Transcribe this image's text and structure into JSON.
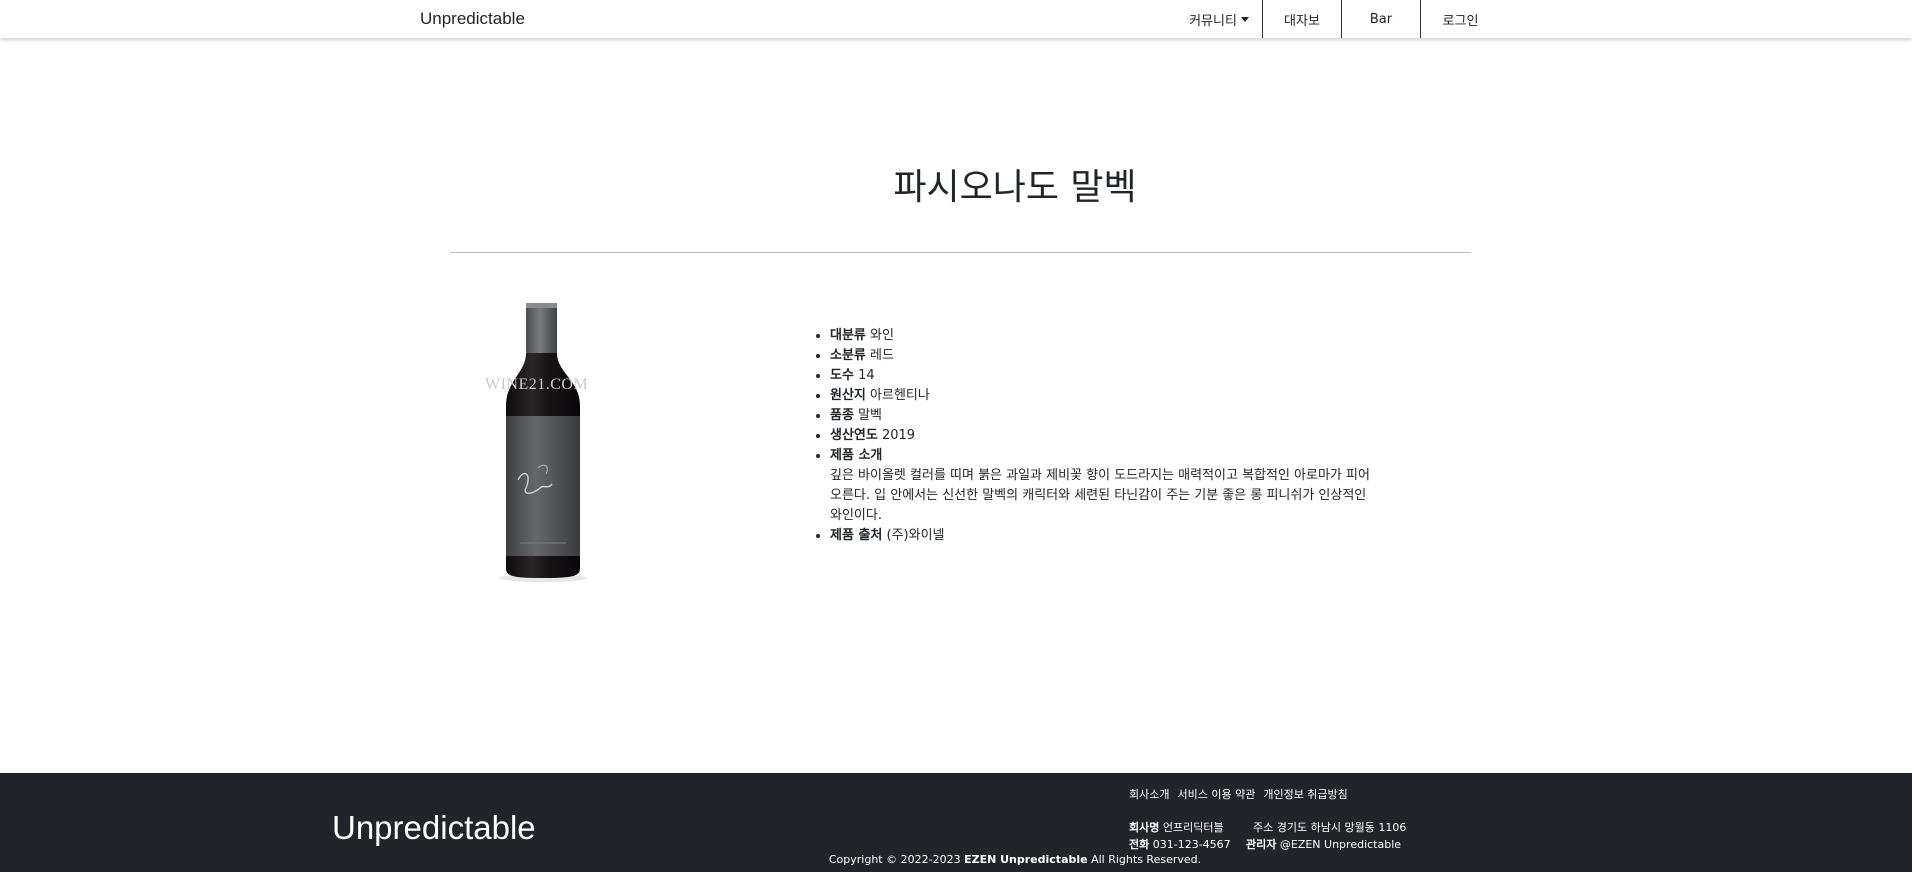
{
  "header": {
    "brand": "Unpredictable",
    "nav": [
      {
        "label": "커뮤니티"
      },
      {
        "label": "대자보"
      },
      {
        "label": "Bar"
      },
      {
        "label": "로그인"
      }
    ]
  },
  "product": {
    "title": "파시오나도 말벡",
    "image_watermark": "WINE21.COM",
    "specs": [
      {
        "label": "대분류",
        "value": "와인"
      },
      {
        "label": "소분류",
        "value": "레드"
      },
      {
        "label": "도수",
        "value": "14"
      },
      {
        "label": "원산지",
        "value": "아르헨티나"
      },
      {
        "label": "품종",
        "value": "말벡"
      },
      {
        "label": "생산연도",
        "value": "2019"
      }
    ],
    "intro_label": "제품 소개",
    "intro_text": "깊은 바이올렛 컬러를 띠며 붉은 과일과 제비꽃 향이 도드라지는 매력적이고 복합적인 아로마가 피어 오른다. 입 안에서는 신선한 말벡의 캐릭터와 세련된 타닌감이 주는 기분 좋은 롱 피니쉬가 인상적인 와인이다.",
    "source_label": "제품 출처",
    "source_value": "(주)와이넬"
  },
  "footer": {
    "brand": "Unpredictable",
    "links": [
      "회사소개",
      "서비스 이용 약관",
      "개인정보 취급방침"
    ],
    "company_label": "회사명",
    "company_value": "언프리딕터블",
    "address_label": "주소",
    "address_value": "경기도 하남시 망월동 1106",
    "phone_label": "전화",
    "phone_value": "031-123-4567",
    "admin_label": "관리자",
    "admin_value": "@EZEN Unpredictable",
    "copyright_prefix": "Copyright © 2022-2023",
    "copyright_brand": "EZEN Unpredictable",
    "copyright_suffix": "All Rights Reserved."
  },
  "colors": {
    "footer_bg": "#212529",
    "bottle_label": "#5a5b5e",
    "bottle_glass": "#1a1718"
  }
}
